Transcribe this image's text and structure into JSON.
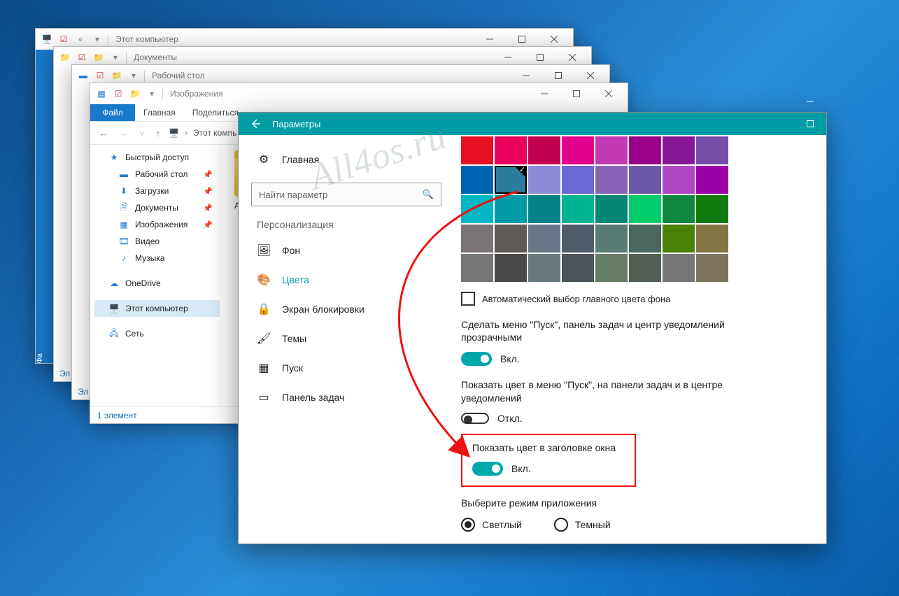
{
  "watermark": "All4os.ru",
  "explorer_windows": [
    {
      "title": "Этот компьютер"
    },
    {
      "title": "Документы"
    },
    {
      "title": "Рабочий стол"
    },
    {
      "title": "Изображения"
    }
  ],
  "explorer_front": {
    "ribbon": {
      "file": "Файл",
      "home": "Главная",
      "share": "Поделиться"
    },
    "breadcrumb_root": "Этот компь",
    "quick_access_label": "Быстрый доступ",
    "items": [
      {
        "label": "Рабочий стол",
        "pin": true
      },
      {
        "label": "Загрузки",
        "pin": true
      },
      {
        "label": "Документы",
        "pin": true
      },
      {
        "label": "Изображения",
        "pin": true
      },
      {
        "label": "Видео",
        "pin": false
      },
      {
        "label": "Музыка",
        "pin": false
      }
    ],
    "onedrive": "OneDrive",
    "this_pc": "Этот компьютер",
    "network": "Сеть",
    "folder_label": "Альб",
    "status": "1 элемент"
  },
  "settings": {
    "title": "Параметры",
    "home": "Главная",
    "search_placeholder": "Найти параметр",
    "section": "Персонализация",
    "nav": [
      {
        "icon": "image",
        "label": "Фон"
      },
      {
        "icon": "palette",
        "label": "Цвета",
        "sel": true
      },
      {
        "icon": "lock",
        "label": "Экран блокировки"
      },
      {
        "icon": "brush",
        "label": "Темы"
      },
      {
        "icon": "grid",
        "label": "Пуск"
      },
      {
        "icon": "taskbar",
        "label": "Панель задач"
      }
    ],
    "auto_color": "Автоматический выбор главного цвета фона",
    "opt_transparent": "Сделать меню \"Пуск\", панель задач и центр уведомлений прозрачными",
    "opt_show_color": "Показать цвет в меню \"Пуск\", на панели задач и в центре уведомлений",
    "opt_title_color": "Показать цвет в заголовке окна",
    "on_label": "Вкл.",
    "off_label": "Откл.",
    "mode_label": "Выберите режим приложения",
    "mode_light": "Светлый",
    "mode_dark": "Темный",
    "swatches": [
      "#e81123",
      "#ea005e",
      "#c30052",
      "#e3008c",
      "#c239b3",
      "#9a0089",
      "#881798",
      "#744da9",
      "#0063b1",
      "#2d7d9a",
      "#8e8cd8",
      "#6b69d6",
      "#8764b8",
      "#6b5aa5",
      "#b146c2",
      "#9a00a5",
      "#00b7c3",
      "#009ca6",
      "#038387",
      "#00b294",
      "#018574",
      "#00cc6a",
      "#10893e",
      "#107c10",
      "#7a7574",
      "#5d5a58",
      "#68768a",
      "#515c6b",
      "#567c73",
      "#486860",
      "#498205",
      "#847545",
      "#767676",
      "#4c4a48",
      "#69797e",
      "#4a5459",
      "#647c64",
      "#525e54",
      "#767676",
      "#7e735f"
    ],
    "selected_swatch_index": 9
  },
  "truncated": {
    "t1": "Эл",
    "t2": "Эл",
    "t3": "Эл"
  }
}
